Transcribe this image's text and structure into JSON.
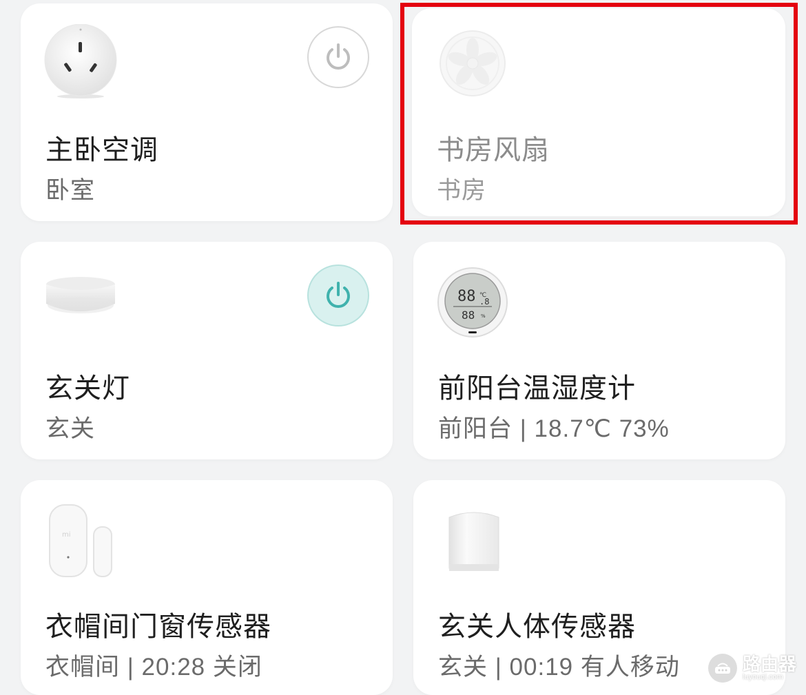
{
  "devices": [
    {
      "name": "主卧空调",
      "sub": "卧室",
      "icon": "smart-plug-icon",
      "power": "off"
    },
    {
      "name": "书房风扇",
      "sub": "书房",
      "icon": "fan-icon",
      "power": null
    },
    {
      "name": "玄关灯",
      "sub": "玄关",
      "icon": "ceiling-light-icon",
      "power": "on"
    },
    {
      "name": "前阳台温湿度计",
      "sub": "前阳台 | 18.7℃ 73%",
      "icon": "thermo-hygrometer-icon",
      "power": null
    },
    {
      "name": "衣帽间门窗传感器",
      "sub": "衣帽间 | 20:28 关闭",
      "icon": "door-window-sensor-icon",
      "power": null
    },
    {
      "name": "玄关人体传感器",
      "sub": "玄关 | 00:19 有人移动",
      "icon": "motion-sensor-icon",
      "power": null
    }
  ],
  "colors": {
    "power_on": "#3fb2ad",
    "highlight": "#e4000f"
  },
  "watermark": {
    "text": "路由器",
    "url": "luyouqi.com"
  }
}
